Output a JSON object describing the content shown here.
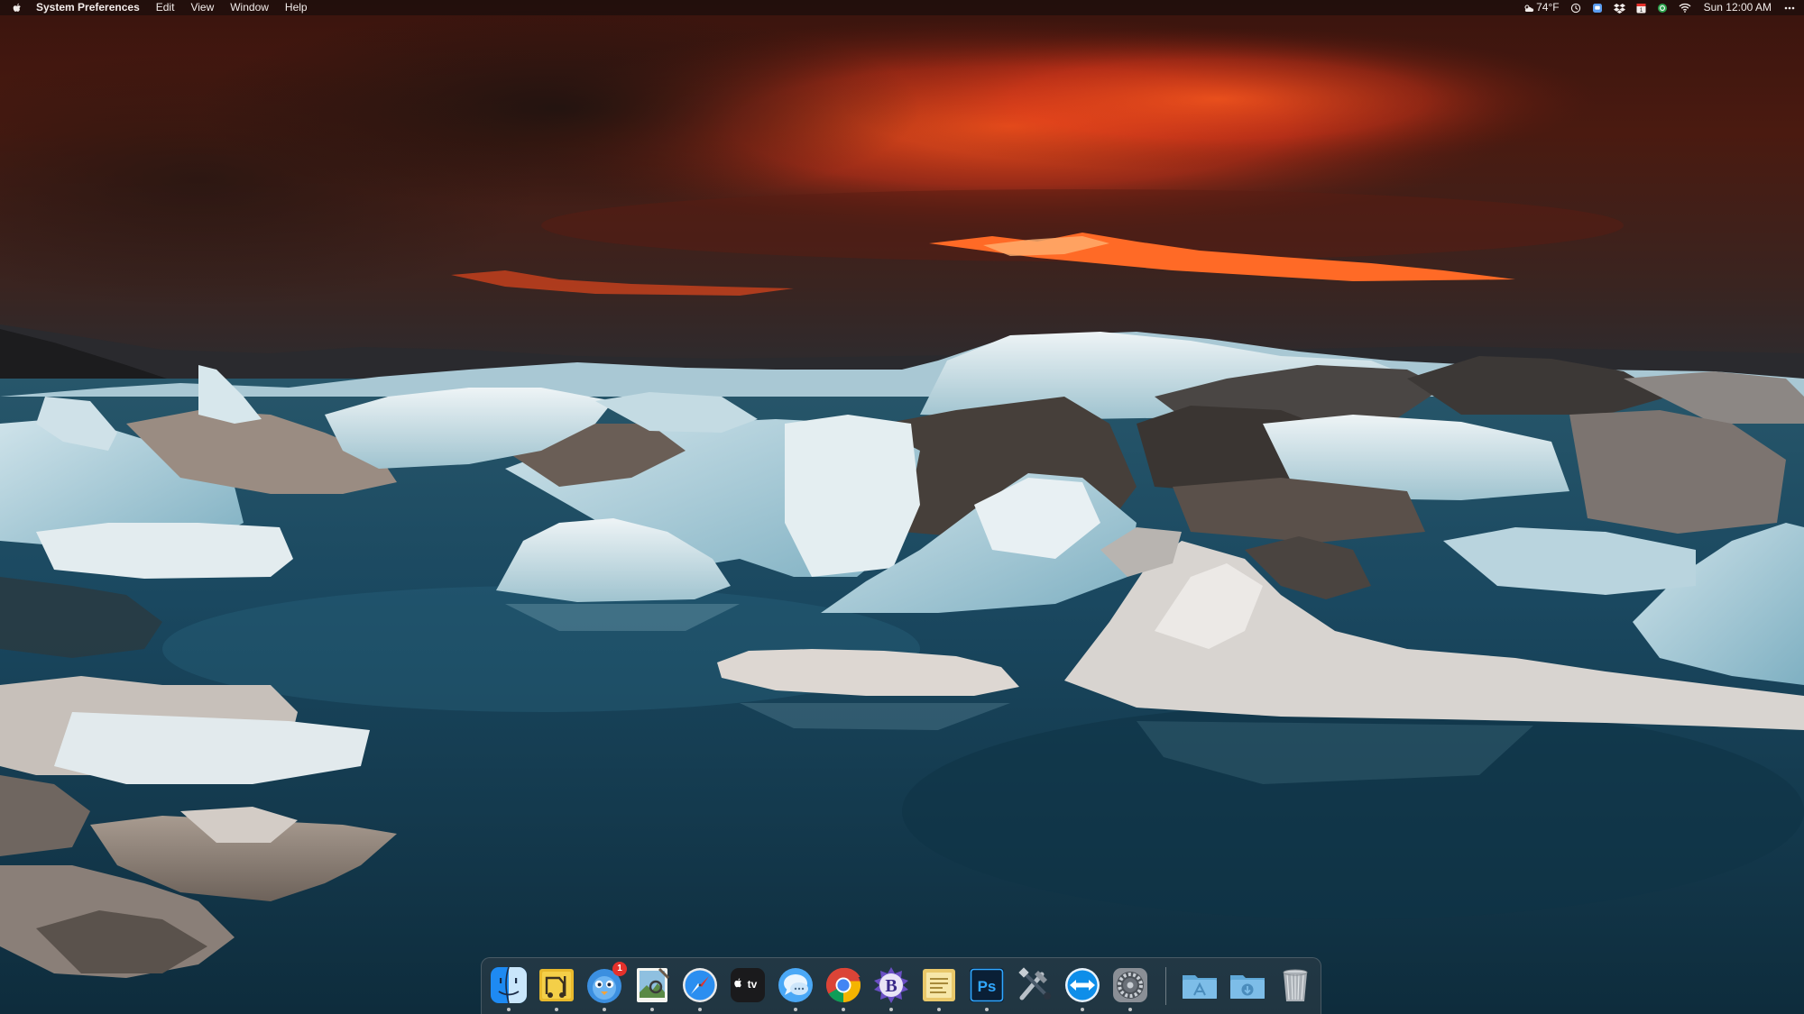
{
  "menubar": {
    "app_name": "System Preferences",
    "menus": [
      "Edit",
      "View",
      "Window",
      "Help"
    ],
    "weather": "74°F",
    "clock": "Sun 12:00 AM",
    "status_icons": [
      "weather-icon",
      "timemachine-icon",
      "scrollbar-icon",
      "dropbox-icon",
      "calendar-icon",
      "vpn-icon",
      "wifi-icon",
      "more-icon"
    ],
    "calendar_day": "1"
  },
  "dock": {
    "apps": [
      {
        "name": "Finder",
        "icon": "finder-icon",
        "running": true
      },
      {
        "name": "Transmit",
        "icon": "transmit-icon",
        "running": true
      },
      {
        "name": "Tweetbot",
        "icon": "tweetbot-icon",
        "running": true,
        "badge": "1"
      },
      {
        "name": "Preview",
        "icon": "preview-icon",
        "running": true
      },
      {
        "name": "Safari",
        "icon": "safari-icon",
        "running": true
      },
      {
        "name": "TV",
        "icon": "appletv-icon",
        "running": false,
        "label": "tv"
      },
      {
        "name": "Messages",
        "icon": "messages-icon",
        "running": true
      },
      {
        "name": "Google Chrome",
        "icon": "chrome-icon",
        "running": true
      },
      {
        "name": "BBEdit",
        "icon": "bbedit-icon",
        "running": true,
        "label": "B"
      },
      {
        "name": "Notes",
        "icon": "notes-icon",
        "running": true
      },
      {
        "name": "Photoshop",
        "icon": "photoshop-icon",
        "running": true,
        "label": "Ps"
      },
      {
        "name": "Tools",
        "icon": "tools-icon",
        "running": false
      },
      {
        "name": "TeamViewer",
        "icon": "teamviewer-icon",
        "running": true
      },
      {
        "name": "System Preferences",
        "icon": "system-preferences-icon",
        "running": true
      }
    ],
    "folders": [
      {
        "name": "Applications",
        "icon": "applications-folder-icon"
      },
      {
        "name": "Downloads",
        "icon": "downloads-folder-icon"
      }
    ],
    "trash": {
      "name": "Trash",
      "icon": "trash-icon"
    }
  },
  "colors": {
    "sky_fire": "#e8481c",
    "water": "#143a4c",
    "ice": "#d9e6ea",
    "badge": "#e5312b"
  }
}
